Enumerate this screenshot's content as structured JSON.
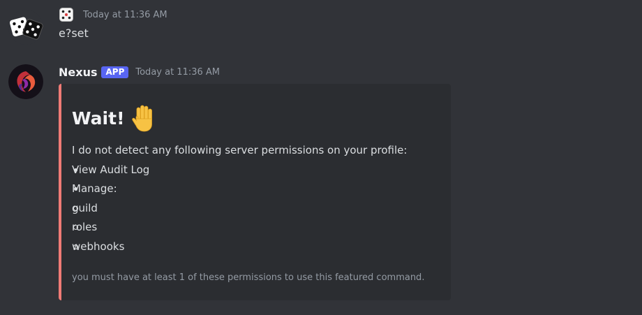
{
  "messages": [
    {
      "timestamp": "Today at 11:36 AM",
      "content": "e?set"
    },
    {
      "username": "Nexus",
      "badge": "APP",
      "timestamp": "Today at 11:36 AM",
      "embed": {
        "accent_color": "#f07b76",
        "title": "Wait!",
        "title_emoji": "raised-hand-icon",
        "intro": "I do not detect any following server permissions on your profile:",
        "items": [
          {
            "label": "View Audit Log"
          },
          {
            "label": "Manage:",
            "subitems": [
              "guild",
              "roles",
              "webhooks"
            ]
          }
        ],
        "footer": "you must have at least 1 of these permissions to use this featured command."
      }
    }
  ],
  "icons": {
    "user1_avatar": "dice-avatar-icon",
    "user1_name_display": "dice-icon",
    "bot_avatar": "phoenix-avatar-icon"
  },
  "colors": {
    "background": "#313338",
    "embed_background": "#2b2d31",
    "app_badge": "#5865f2"
  }
}
